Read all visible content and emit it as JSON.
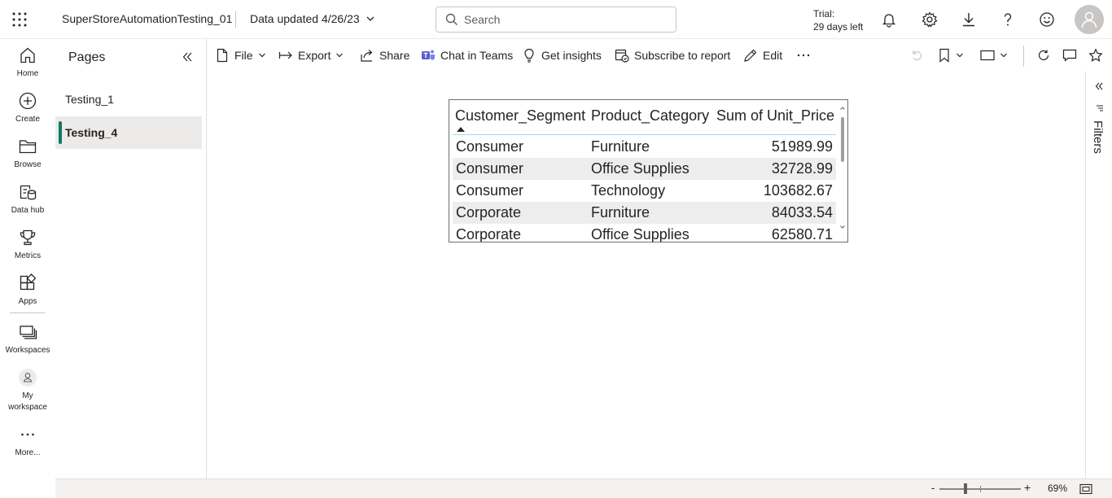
{
  "header": {
    "report_title": "SuperStoreAutomationTesting_01",
    "data_updated": "Data updated 4/26/23",
    "search_placeholder": "Search",
    "trial_line1": "Trial:",
    "trial_line2": "29 days left"
  },
  "leftnav": {
    "items": [
      {
        "label": "Home",
        "icon": "home-icon"
      },
      {
        "label": "Create",
        "icon": "create-icon"
      },
      {
        "label": "Browse",
        "icon": "browse-icon"
      },
      {
        "label": "Data hub",
        "icon": "data-hub-icon"
      },
      {
        "label": "Metrics",
        "icon": "metrics-icon"
      },
      {
        "label": "Apps",
        "icon": "apps-icon"
      },
      {
        "label": "Workspaces",
        "icon": "workspaces-icon"
      },
      {
        "label_line1": "My",
        "label_line2": "workspace",
        "icon": "my-workspace-icon"
      },
      {
        "label": "More...",
        "icon": "more-icon"
      }
    ]
  },
  "pages": {
    "title": "Pages",
    "items": [
      {
        "label": "Testing_1",
        "active": false
      },
      {
        "label": "Testing_4",
        "active": true
      }
    ]
  },
  "actionbar": {
    "file": "File",
    "export": "Export",
    "share": "Share",
    "chat": "Chat in Teams",
    "insights": "Get insights",
    "subscribe": "Subscribe to report",
    "edit": "Edit"
  },
  "table": {
    "columns": [
      "Customer_Segment",
      "Product_Category",
      "Sum of Unit_Price"
    ],
    "rows": [
      [
        "Consumer",
        "Furniture",
        "51989.99"
      ],
      [
        "Consumer",
        "Office Supplies",
        "32728.99"
      ],
      [
        "Consumer",
        "Technology",
        "103682.67"
      ],
      [
        "Corporate",
        "Furniture",
        "84033.54"
      ],
      [
        "Corporate",
        "Office Supplies",
        "62580.71"
      ]
    ]
  },
  "filters": {
    "label": "Filters"
  },
  "statusbar": {
    "zoom": "69%",
    "minus": "-",
    "plus": "+"
  },
  "colors": {
    "active_page_accent": "#117865",
    "teams_purple": "#5b5fc7"
  }
}
